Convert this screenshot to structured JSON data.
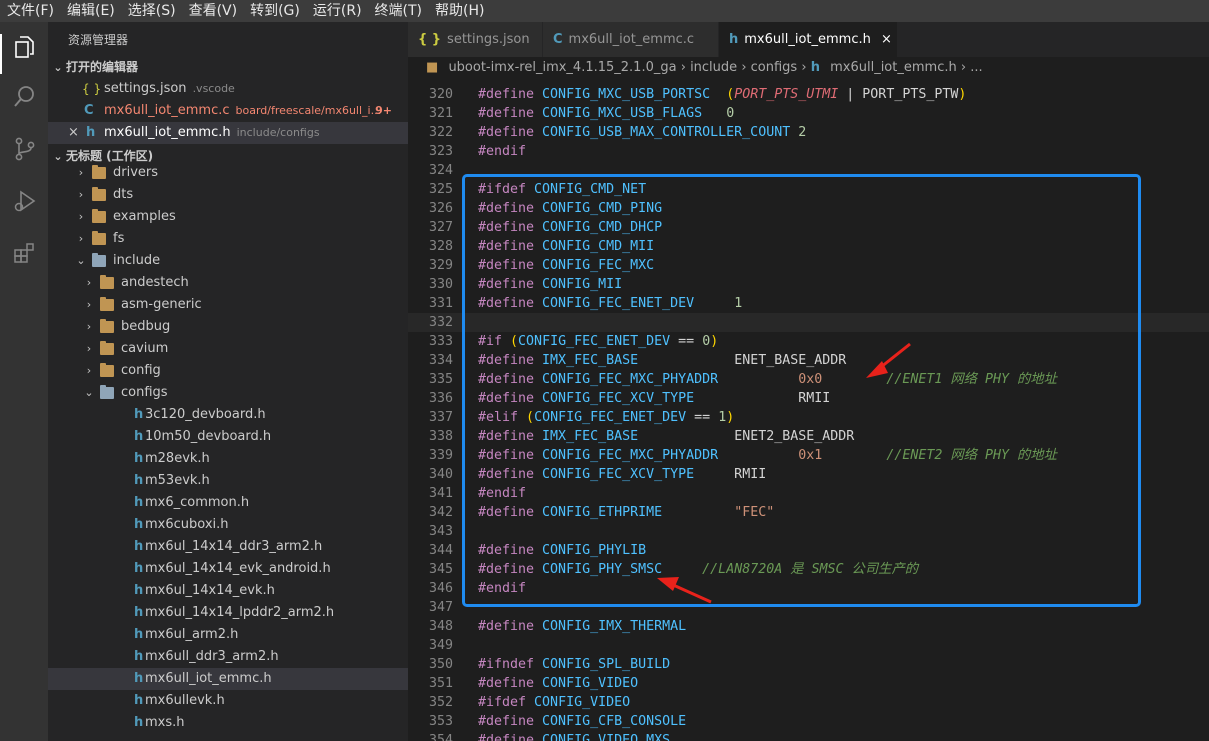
{
  "menu": [
    "文件(F)",
    "编辑(E)",
    "选择(S)",
    "查看(V)",
    "转到(G)",
    "运行(R)",
    "终端(T)",
    "帮助(H)"
  ],
  "sidebar": {
    "title": "资源管理器",
    "open_editors_label": "打开的编辑器",
    "open_editors": [
      {
        "icon": "{ }",
        "name": "settings.json",
        "desc": ".vscode",
        "badge": ""
      },
      {
        "icon": "C",
        "name": "mx6ull_iot_emmc.c",
        "desc": "board/freescale/mx6ull_i...",
        "badge": "9+"
      },
      {
        "icon": "h",
        "name": "mx6ull_iot_emmc.h",
        "desc": "include/configs",
        "badge": ""
      }
    ],
    "workspace_label": "无标题 (工作区)",
    "tree": [
      {
        "type": "folder",
        "depth": 0,
        "label": "drivers",
        "open": false
      },
      {
        "type": "folder",
        "depth": 0,
        "label": "dts",
        "open": false
      },
      {
        "type": "folder",
        "depth": 0,
        "label": "examples",
        "open": false
      },
      {
        "type": "folder",
        "depth": 0,
        "label": "fs",
        "open": false
      },
      {
        "type": "folder",
        "depth": 0,
        "label": "include",
        "open": true
      },
      {
        "type": "folder",
        "depth": 1,
        "label": "andestech",
        "open": false
      },
      {
        "type": "folder",
        "depth": 1,
        "label": "asm-generic",
        "open": false
      },
      {
        "type": "folder",
        "depth": 1,
        "label": "bedbug",
        "open": false
      },
      {
        "type": "folder",
        "depth": 1,
        "label": "cavium",
        "open": false
      },
      {
        "type": "folder",
        "depth": 1,
        "label": "config",
        "open": false
      },
      {
        "type": "folder",
        "depth": 1,
        "label": "configs",
        "open": true
      },
      {
        "type": "file",
        "depth": 2,
        "label": "3c120_devboard.h"
      },
      {
        "type": "file",
        "depth": 2,
        "label": "10m50_devboard.h"
      },
      {
        "type": "file",
        "depth": 2,
        "label": "m28evk.h"
      },
      {
        "type": "file",
        "depth": 2,
        "label": "m53evk.h"
      },
      {
        "type": "file",
        "depth": 2,
        "label": "mx6_common.h"
      },
      {
        "type": "file",
        "depth": 2,
        "label": "mx6cuboxi.h"
      },
      {
        "type": "file",
        "depth": 2,
        "label": "mx6ul_14x14_ddr3_arm2.h"
      },
      {
        "type": "file",
        "depth": 2,
        "label": "mx6ul_14x14_evk_android.h"
      },
      {
        "type": "file",
        "depth": 2,
        "label": "mx6ul_14x14_evk.h"
      },
      {
        "type": "file",
        "depth": 2,
        "label": "mx6ul_14x14_lpddr2_arm2.h"
      },
      {
        "type": "file",
        "depth": 2,
        "label": "mx6ul_arm2.h"
      },
      {
        "type": "file",
        "depth": 2,
        "label": "mx6ull_ddr3_arm2.h"
      },
      {
        "type": "file",
        "depth": 2,
        "label": "mx6ull_iot_emmc.h",
        "selected": true
      },
      {
        "type": "file",
        "depth": 2,
        "label": "mx6ullevk.h"
      },
      {
        "type": "file",
        "depth": 2,
        "label": "mxs.h"
      }
    ]
  },
  "tabs": [
    {
      "icon": "{ }",
      "label": "settings.json",
      "active": false
    },
    {
      "icon": "C",
      "label": "mx6ull_iot_emmc.c",
      "active": false
    },
    {
      "icon": "h",
      "label": "mx6ull_iot_emmc.h",
      "active": true,
      "close": "×"
    }
  ],
  "breadcrumb": [
    "uboot-imx-rel_imx_4.1.15_2.1.0_ga",
    "include",
    "configs",
    "mx6ull_iot_emmc.h",
    "..."
  ],
  "code_lines": [
    {
      "n": "320",
      "parts": [
        [
          "kw",
          "#define "
        ],
        [
          "mac",
          "CONFIG_MXC_USB_PORTSC"
        ],
        [
          "",
          "  "
        ],
        [
          "par",
          "("
        ],
        [
          "ital",
          "PORT_PTS_UTMI"
        ],
        [
          "",
          " | PORT_PTS_PTW"
        ],
        [
          "par",
          ")"
        ]
      ]
    },
    {
      "n": "321",
      "parts": [
        [
          "kw",
          "#define "
        ],
        [
          "mac",
          "CONFIG_MXC_USB_FLAGS"
        ],
        [
          "",
          "   "
        ],
        [
          "num",
          "0"
        ]
      ]
    },
    {
      "n": "322",
      "parts": [
        [
          "kw",
          "#define "
        ],
        [
          "mac",
          "CONFIG_USB_MAX_CONTROLLER_COUNT"
        ],
        [
          "",
          " "
        ],
        [
          "num",
          "2"
        ]
      ]
    },
    {
      "n": "323",
      "parts": [
        [
          "kw",
          "#endif"
        ]
      ]
    },
    {
      "n": "324",
      "parts": []
    },
    {
      "n": "325",
      "parts": [
        [
          "kw",
          "#ifdef "
        ],
        [
          "mac",
          "CONFIG_CMD_NET"
        ]
      ]
    },
    {
      "n": "326",
      "parts": [
        [
          "kw",
          "#define "
        ],
        [
          "mac",
          "CONFIG_CMD_PING"
        ]
      ]
    },
    {
      "n": "327",
      "parts": [
        [
          "kw",
          "#define "
        ],
        [
          "mac",
          "CONFIG_CMD_DHCP"
        ]
      ]
    },
    {
      "n": "328",
      "parts": [
        [
          "kw",
          "#define "
        ],
        [
          "mac",
          "CONFIG_CMD_MII"
        ]
      ]
    },
    {
      "n": "329",
      "parts": [
        [
          "kw",
          "#define "
        ],
        [
          "mac",
          "CONFIG_FEC_MXC"
        ]
      ]
    },
    {
      "n": "330",
      "parts": [
        [
          "kw",
          "#define "
        ],
        [
          "mac",
          "CONFIG_MII"
        ]
      ]
    },
    {
      "n": "331",
      "parts": [
        [
          "kw",
          "#define "
        ],
        [
          "mac",
          "CONFIG_FEC_ENET_DEV"
        ],
        [
          "",
          "     "
        ],
        [
          "num",
          "1"
        ]
      ]
    },
    {
      "n": "332",
      "parts": [],
      "current": true
    },
    {
      "n": "333",
      "parts": [
        [
          "kw",
          "#if "
        ],
        [
          "par",
          "("
        ],
        [
          "mac",
          "CONFIG_FEC_ENET_DEV"
        ],
        [
          "",
          " == "
        ],
        [
          "num",
          "0"
        ],
        [
          "par",
          ")"
        ]
      ]
    },
    {
      "n": "334",
      "parts": [
        [
          "kw",
          "#define "
        ],
        [
          "mac",
          "IMX_FEC_BASE"
        ],
        [
          "",
          "            ENET_BASE_ADDR"
        ]
      ]
    },
    {
      "n": "335",
      "parts": [
        [
          "kw",
          "#define "
        ],
        [
          "mac",
          "CONFIG_FEC_MXC_PHYADDR"
        ],
        [
          "",
          "          "
        ],
        [
          "str",
          "0x0"
        ],
        [
          "",
          "        "
        ],
        [
          "cmt",
          "//ENET1 网络 PHY 的地址"
        ]
      ]
    },
    {
      "n": "336",
      "parts": [
        [
          "kw",
          "#define "
        ],
        [
          "mac",
          "CONFIG_FEC_XCV_TYPE"
        ],
        [
          "",
          "             RMII"
        ]
      ]
    },
    {
      "n": "337",
      "parts": [
        [
          "kw",
          "#elif "
        ],
        [
          "par",
          "("
        ],
        [
          "mac",
          "CONFIG_FEC_ENET_DEV"
        ],
        [
          "",
          " == "
        ],
        [
          "num",
          "1"
        ],
        [
          "par",
          ")"
        ]
      ]
    },
    {
      "n": "338",
      "parts": [
        [
          "kw",
          "#define "
        ],
        [
          "mac",
          "IMX_FEC_BASE"
        ],
        [
          "",
          "            ENET2_BASE_ADDR"
        ]
      ]
    },
    {
      "n": "339",
      "parts": [
        [
          "kw",
          "#define "
        ],
        [
          "mac",
          "CONFIG_FEC_MXC_PHYADDR"
        ],
        [
          "",
          "          "
        ],
        [
          "str",
          "0x1"
        ],
        [
          "",
          "        "
        ],
        [
          "cmt",
          "//ENET2 网络 PHY 的地址"
        ]
      ]
    },
    {
      "n": "340",
      "parts": [
        [
          "kw",
          "#define "
        ],
        [
          "mac",
          "CONFIG_FEC_XCV_TYPE"
        ],
        [
          "",
          "     RMII"
        ]
      ]
    },
    {
      "n": "341",
      "parts": [
        [
          "kw",
          "#endif"
        ]
      ]
    },
    {
      "n": "342",
      "parts": [
        [
          "kw",
          "#define "
        ],
        [
          "mac",
          "CONFIG_ETHPRIME"
        ],
        [
          "",
          "         "
        ],
        [
          "str",
          "\"FEC\""
        ]
      ]
    },
    {
      "n": "343",
      "parts": []
    },
    {
      "n": "344",
      "parts": [
        [
          "kw",
          "#define "
        ],
        [
          "mac",
          "CONFIG_PHYLIB"
        ]
      ]
    },
    {
      "n": "345",
      "parts": [
        [
          "kw",
          "#define "
        ],
        [
          "mac",
          "CONFIG_PHY_SMSC"
        ],
        [
          "",
          "     "
        ],
        [
          "cmt",
          "//LAN8720A 是 SMSC 公司生产的"
        ]
      ]
    },
    {
      "n": "346",
      "parts": [
        [
          "kw",
          "#endif"
        ]
      ]
    },
    {
      "n": "347",
      "parts": []
    },
    {
      "n": "348",
      "parts": [
        [
          "kw",
          "#define "
        ],
        [
          "mac",
          "CONFIG_IMX_THERMAL"
        ]
      ]
    },
    {
      "n": "349",
      "parts": []
    },
    {
      "n": "350",
      "parts": [
        [
          "kw",
          "#ifndef "
        ],
        [
          "mac",
          "CONFIG_SPL_BUILD"
        ]
      ]
    },
    {
      "n": "351",
      "parts": [
        [
          "kw",
          "#define "
        ],
        [
          "mac",
          "CONFIG_VIDEO"
        ]
      ]
    },
    {
      "n": "352",
      "parts": [
        [
          "kw",
          "#ifdef "
        ],
        [
          "mac",
          "CONFIG_VIDEO"
        ]
      ]
    },
    {
      "n": "353",
      "parts": [
        [
          "kw",
          "#define "
        ],
        [
          "mac",
          "CONFIG_CFB_CONSOLE"
        ]
      ]
    },
    {
      "n": "354",
      "parts": [
        [
          "kw",
          "#define "
        ],
        [
          "mac",
          "CONFIG_VIDEO_MXS"
        ]
      ]
    }
  ],
  "colors": {
    "highlight_box": "#1f8bf0",
    "arrow": "#e8221b",
    "accent": "#007acc"
  }
}
